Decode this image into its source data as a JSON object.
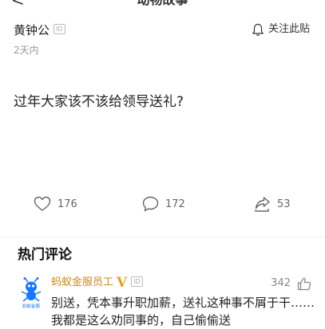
{
  "nav": {
    "back_glyph": "<",
    "title": "动物故事"
  },
  "post": {
    "author": "黄钟公",
    "author_badge": "ID",
    "time": "2天内",
    "follow_label": "关注此贴",
    "question": "过年大家该不该给领导送礼?"
  },
  "stats": {
    "likes": "176",
    "comments": "172",
    "shares": "53"
  },
  "comments_section": {
    "title": "热门评论",
    "items": [
      {
        "author": "蚂蚁金服员工",
        "vip": "V",
        "badge": "ID",
        "likes": "342",
        "avatar_caption": "蚂蚁金服",
        "text": "别送，凭本事升职加薪，送礼这种事不屑于干……我都是这么劝同事的，自己偷偷送"
      }
    ]
  },
  "colors": {
    "author_gold": "#cc8a16",
    "vip_gold": "#e6a21a",
    "avatar_blue": "#1677ff"
  }
}
